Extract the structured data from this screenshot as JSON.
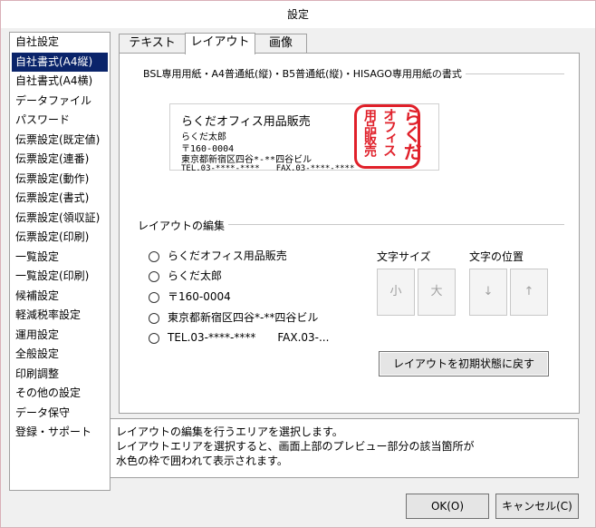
{
  "window": {
    "title": "設定"
  },
  "sidebar": {
    "items": [
      {
        "label": "自社設定"
      },
      {
        "label": "自社書式(A4縦)",
        "selected": true
      },
      {
        "label": "自社書式(A4横)"
      },
      {
        "label": "データファイル"
      },
      {
        "label": "パスワード"
      },
      {
        "label": "伝票設定(既定値)"
      },
      {
        "label": "伝票設定(連番)"
      },
      {
        "label": "伝票設定(動作)"
      },
      {
        "label": "伝票設定(書式)"
      },
      {
        "label": "伝票設定(領収証)"
      },
      {
        "label": "伝票設定(印刷)"
      },
      {
        "label": "一覧設定"
      },
      {
        "label": "一覧設定(印刷)"
      },
      {
        "label": "候補設定"
      },
      {
        "label": "軽減税率設定"
      },
      {
        "label": "運用設定"
      },
      {
        "label": "全般設定"
      },
      {
        "label": "印刷調整"
      },
      {
        "label": "その他の設定"
      },
      {
        "label": "データ保守"
      },
      {
        "label": "登録・サポート"
      }
    ]
  },
  "tabs": [
    {
      "label": "テキスト"
    },
    {
      "label": "レイアウト",
      "active": true
    },
    {
      "label": "画像"
    }
  ],
  "format_group": {
    "title": "BSL専用用紙・A4普通紙(縦)・B5普通紙(縦)・HISAGO専用用紙の書式"
  },
  "preview": {
    "company": "らくだオフィス用品販売",
    "person": "らくだ太郎",
    "postal": "〒160-0004",
    "address": "東京都新宿区四谷*-**四谷ビル",
    "phone": "TEL.03-****-****　　FAX.03-****-****",
    "stamp_col1": "らくだ",
    "stamp_col2": "オフィス",
    "stamp_col3": "用品販売",
    "stamp_color": "#e0202a"
  },
  "layout_edit": {
    "title": "レイアウトの編集",
    "options": [
      {
        "label": "らくだオフィス用品販売"
      },
      {
        "label": "らくだ太郎"
      },
      {
        "label": "〒160-0004"
      },
      {
        "label": "東京都新宿区四谷*-**四谷ビル"
      },
      {
        "label": "TEL.03-****-****　　FAX.03-..."
      }
    ],
    "font_size_label": "文字サイズ",
    "font_small": "小",
    "font_large": "大",
    "position_label": "文字の位置",
    "pos_down": "↓",
    "pos_up": "↑",
    "reset_label": "レイアウトを初期状態に戻す"
  },
  "message": {
    "line1": "レイアウトの編集を行うエリアを選択します。",
    "line2": "レイアウトエリアを選択すると、画面上部のプレビュー部分の該当箇所が",
    "line3": "水色の枠で囲われて表示されます。"
  },
  "footer": {
    "ok_label": "OK(O)",
    "cancel_label": "キャンセル(C)"
  }
}
